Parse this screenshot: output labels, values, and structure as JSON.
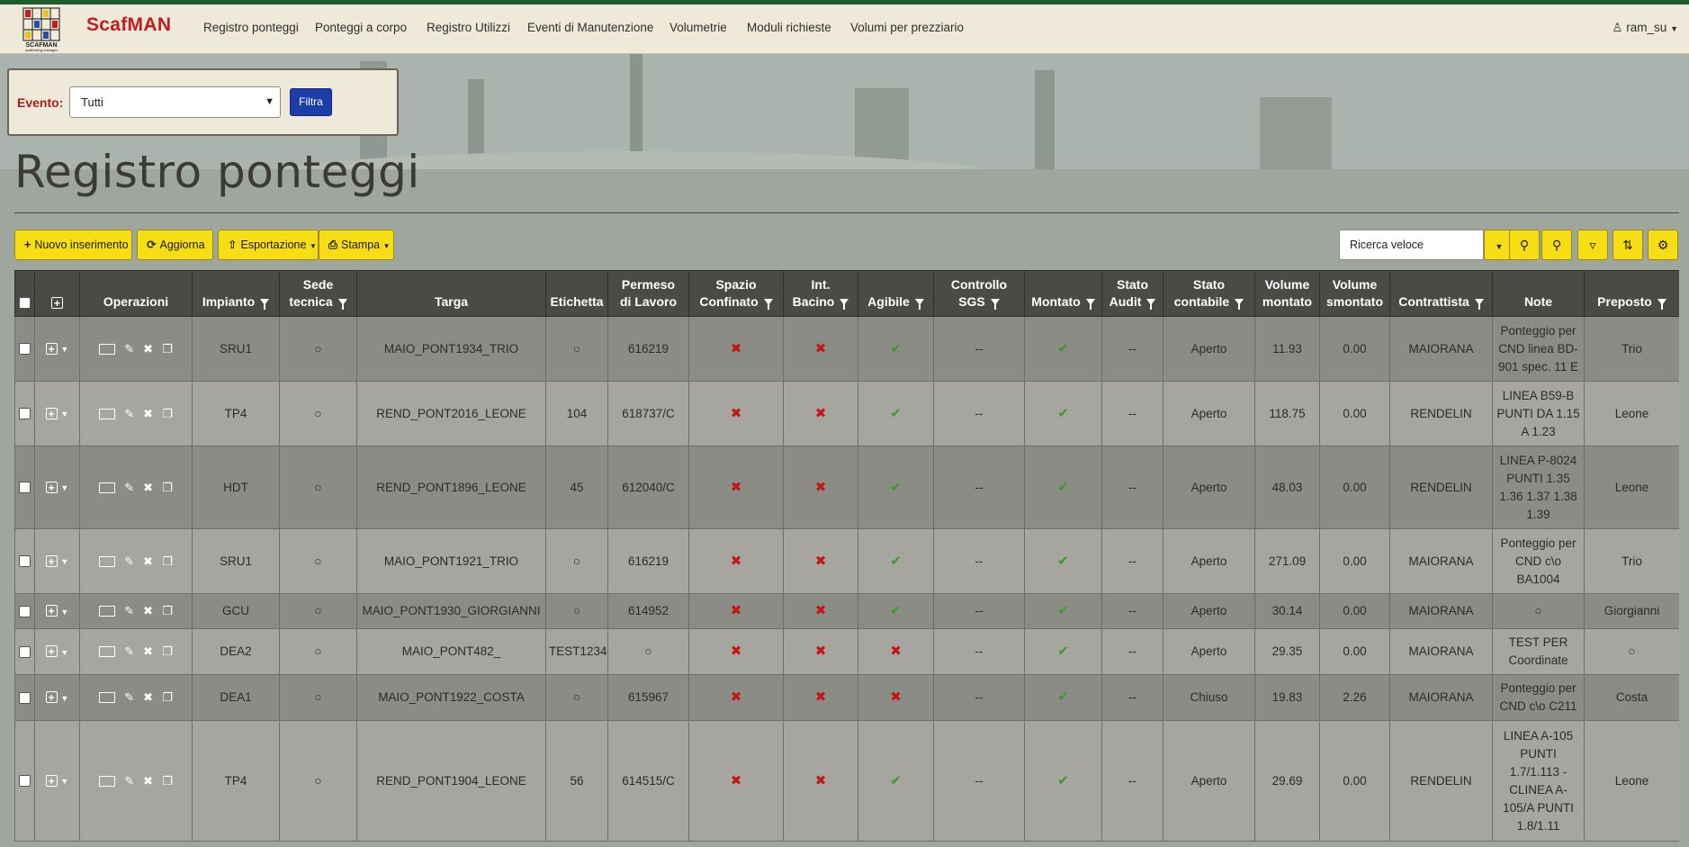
{
  "app": {
    "brand": "ScafMAN",
    "logo_subtitle": "SCAFMAN scaffolding manager",
    "nav": [
      "Registro ponteggi",
      "Ponteggi a corpo",
      "Registro Utilizzi",
      "Eventi di Manutenzione",
      "Volumetrie",
      "Moduli richieste",
      "Volumi per prezziario"
    ],
    "user": "ram_su"
  },
  "filter": {
    "label": "Evento:",
    "selected": "Tutti",
    "button": "Filtra"
  },
  "page": {
    "title": "Registro ponteggi"
  },
  "toolbar": {
    "new": "Nuovo inserimento",
    "refresh": "Aggiorna",
    "export": "Esportazione",
    "print": "Stampa",
    "search_placeholder": "Ricerca veloce"
  },
  "table": {
    "headers": {
      "operazioni": "Operazioni",
      "impianto": "Impianto",
      "sede1": "Sede",
      "sede2": "tecnica",
      "targa": "Targa",
      "etichetta": "Etichetta",
      "permesso1": "Permeso",
      "permesso2": "di Lavoro",
      "spazio1": "Spazio",
      "spazio2": "Confinato",
      "bacino1": "Int.",
      "bacino2": "Bacino",
      "agibile": "Agibile",
      "controllo1": "Controllo",
      "controllo2": "SGS",
      "montato": "Montato",
      "audit1": "Stato",
      "audit2": "Audit",
      "contabile1": "Stato",
      "contabile2": "contabile",
      "vmont1": "Volume",
      "vmont2": "montato",
      "vsmont1": "Volume",
      "vsmont2": "smontato",
      "contrattista": "Contrattista",
      "note": "Note",
      "preposto": "Preposto"
    },
    "rows": [
      {
        "impianto": "SRU1",
        "sede": "○",
        "targa": "MAIO_PONT1934_TRIO",
        "etichetta": "○",
        "permesso": "616219",
        "spazio": "✖",
        "bacino": "✖",
        "agibile": "✔",
        "sgs": "--",
        "montato": "✔",
        "audit": "--",
        "contabile": "Aperto",
        "vmont": "11.93",
        "vsmont": "0.00",
        "contrattista": "MAIORANA",
        "note": "Ponteggio per CND linea BD-901 spec. 11 E",
        "preposto": "Trio"
      },
      {
        "impianto": "TP4",
        "sede": "○",
        "targa": "REND_PONT2016_LEONE",
        "etichetta": "104",
        "permesso": "618737/C",
        "spazio": "✖",
        "bacino": "✖",
        "agibile": "✔",
        "sgs": "--",
        "montato": "✔",
        "audit": "--",
        "contabile": "Aperto",
        "vmont": "118.75",
        "vsmont": "0.00",
        "contrattista": "RENDELIN",
        "note": "LINEA B59-B PUNTI DA 1.15 A 1.23",
        "preposto": "Leone"
      },
      {
        "impianto": "HDT",
        "sede": "○",
        "targa": "REND_PONT1896_LEONE",
        "etichetta": "45",
        "permesso": "612040/C",
        "spazio": "✖",
        "bacino": "✖",
        "agibile": "✔",
        "sgs": "--",
        "montato": "✔",
        "audit": "--",
        "contabile": "Aperto",
        "vmont": "48.03",
        "vsmont": "0.00",
        "contrattista": "RENDELIN",
        "note": "LINEA P-8024 PUNTI 1.35 1.36 1.37 1.38 1.39",
        "preposto": "Leone"
      },
      {
        "impianto": "SRU1",
        "sede": "○",
        "targa": "MAIO_PONT1921_TRIO",
        "etichetta": "○",
        "permesso": "616219",
        "spazio": "✖",
        "bacino": "✖",
        "agibile": "✔",
        "sgs": "--",
        "montato": "✔",
        "audit": "--",
        "contabile": "Aperto",
        "vmont": "271.09",
        "vsmont": "0.00",
        "contrattista": "MAIORANA",
        "note": "Ponteggio per CND c\\o BA1004",
        "preposto": "Trio"
      },
      {
        "impianto": "GCU",
        "sede": "○",
        "targa": "MAIO_PONT1930_GIORGIANNI",
        "etichetta": "○",
        "permesso": "614952",
        "spazio": "✖",
        "bacino": "✖",
        "agibile": "✔",
        "sgs": "--",
        "montato": "✔",
        "audit": "--",
        "contabile": "Aperto",
        "vmont": "30.14",
        "vsmont": "0.00",
        "contrattista": "MAIORANA",
        "note": "○",
        "preposto": "Giorgianni"
      },
      {
        "impianto": "DEA2",
        "sede": "○",
        "targa": "MAIO_PONT482_",
        "etichetta": "TEST1234",
        "permesso": "○",
        "spazio": "✖",
        "bacino": "✖",
        "agibile": "✖",
        "sgs": "--",
        "montato": "✔",
        "audit": "--",
        "contabile": "Aperto",
        "vmont": "29.35",
        "vsmont": "0.00",
        "contrattista": "MAIORANA",
        "note": "TEST PER Coordinate",
        "preposto": "○"
      },
      {
        "impianto": "DEA1",
        "sede": "○",
        "targa": "MAIO_PONT1922_COSTA",
        "etichetta": "○",
        "permesso": "615967",
        "spazio": "✖",
        "bacino": "✖",
        "agibile": "✖",
        "sgs": "--",
        "montato": "✔",
        "audit": "--",
        "contabile": "Chiuso",
        "vmont": "19.83",
        "vsmont": "2.26",
        "contrattista": "MAIORANA",
        "note": "Ponteggio per CND c\\o C211",
        "preposto": "Costa"
      },
      {
        "impianto": "TP4",
        "sede": "○",
        "targa": "REND_PONT1904_LEONE",
        "etichetta": "56",
        "permesso": "614515/C",
        "spazio": "✖",
        "bacino": "✖",
        "agibile": "✔",
        "sgs": "--",
        "montato": "✔",
        "audit": "--",
        "contabile": "Aperto",
        "vmont": "29.69",
        "vsmont": "0.00",
        "contrattista": "RENDELIN",
        "note": "LINEA A-105 PUNTI 1.7/1.113 - CLINEA A-105/A PUNTI 1.8/1.11",
        "preposto": "Leone"
      }
    ]
  }
}
